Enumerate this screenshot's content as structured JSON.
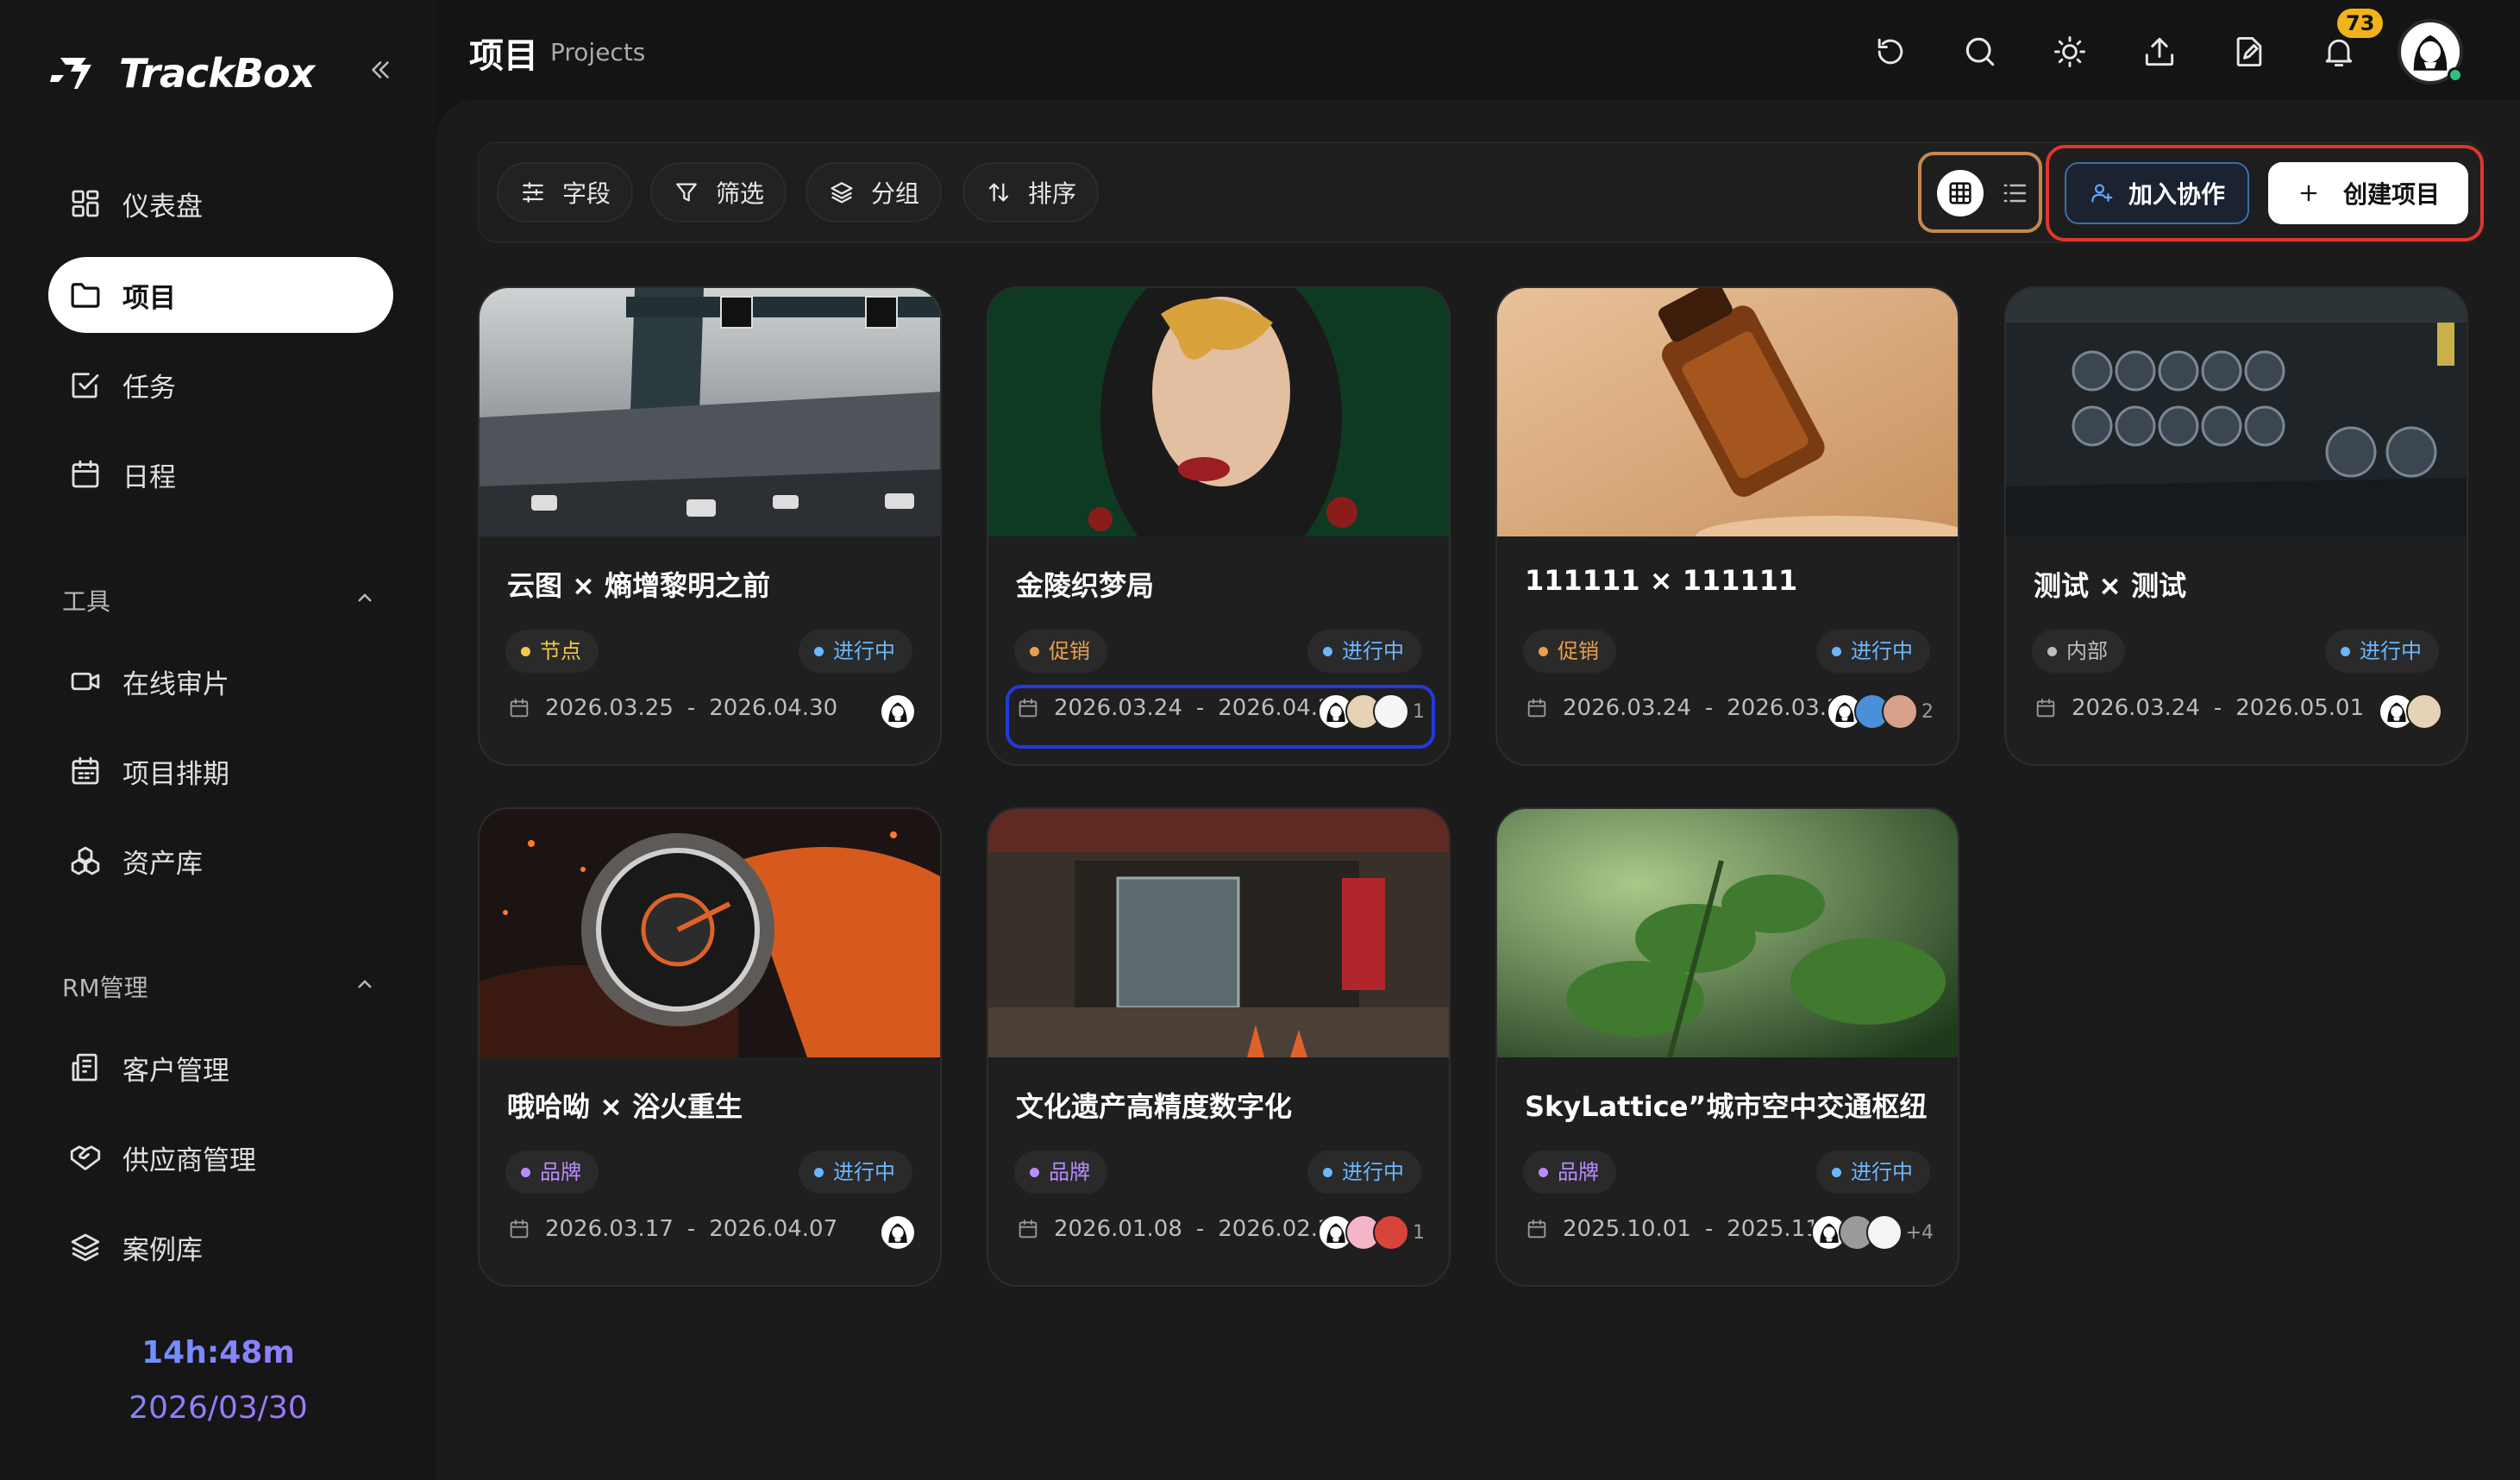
{
  "app": {
    "name": "TrackBox"
  },
  "sidebar": {
    "nav": [
      {
        "label": "仪表盘",
        "icon": "dashboard-icon"
      },
      {
        "label": "项目",
        "icon": "folder-icon"
      },
      {
        "label": "任务",
        "icon": "task-check-icon"
      },
      {
        "label": "日程",
        "icon": "calendar-icon"
      }
    ],
    "tools_title": "工具",
    "tools": [
      {
        "label": "在线审片",
        "icon": "video-camera-icon"
      },
      {
        "label": "项目排期",
        "icon": "schedule-icon"
      },
      {
        "label": "资产库",
        "icon": "assets-icon"
      }
    ],
    "rm_title": "RM管理",
    "rm": [
      {
        "label": "客户管理",
        "icon": "client-icon"
      },
      {
        "label": "供应商管理",
        "icon": "supplier-handshake-icon"
      },
      {
        "label": "案例库",
        "icon": "layers-icon"
      }
    ],
    "clock_time": "14h:48m",
    "clock_date": "2026/03/30"
  },
  "header": {
    "title": "项目",
    "subtitle": "Projects",
    "notification_count": "73"
  },
  "toolbar": {
    "fields": "字段",
    "filter": "筛选",
    "group": "分组",
    "sort": "排序",
    "join": "加入协作",
    "create": "创建项目"
  },
  "projects": [
    {
      "title": "云图 × 熵增黎明之前",
      "type": "节点",
      "type_color": "#f2c94c",
      "status": "进行中",
      "start": "2026.03.25",
      "end": "2026.04.30",
      "extra": ""
    },
    {
      "title": "金陵织梦局",
      "type": "促销",
      "type_color": "#e8a04c",
      "status": "进行中",
      "start": "2026.03.24",
      "end": "2026.04.28",
      "extra": "1"
    },
    {
      "title": "111111 × 111111",
      "type": "促销",
      "type_color": "#e8a04c",
      "status": "进行中",
      "start": "2026.03.24",
      "end": "2026.03.27",
      "extra": "2"
    },
    {
      "title": "测试 × 测试",
      "type": "内部",
      "type_color": "#bdbdbd",
      "status": "进行中",
      "start": "2026.03.24",
      "end": "2026.05.01",
      "extra": ""
    },
    {
      "title": "哦哈呦 × 浴火重生",
      "type": "品牌",
      "type_color": "#b98cff",
      "status": "进行中",
      "start": "2026.03.17",
      "end": "2026.04.07",
      "extra": ""
    },
    {
      "title": "文化遗产高精度数字化",
      "type": "品牌",
      "type_color": "#b98cff",
      "status": "进行中",
      "start": "2026.01.08",
      "end": "2026.02.21",
      "extra": "1"
    },
    {
      "title": "SkyLattice”城市空中交通枢纽",
      "type": "品牌",
      "type_color": "#b98cff",
      "status": "进行中",
      "start": "2025.10.01",
      "end": "2025.11.01",
      "extra": "+4"
    }
  ],
  "date_separator": "-",
  "colors": {
    "accent_blue": "#2438e0",
    "accent_orange": "#c4884e",
    "accent_red": "#e0362e",
    "status_blue": "#6bb7ff"
  }
}
